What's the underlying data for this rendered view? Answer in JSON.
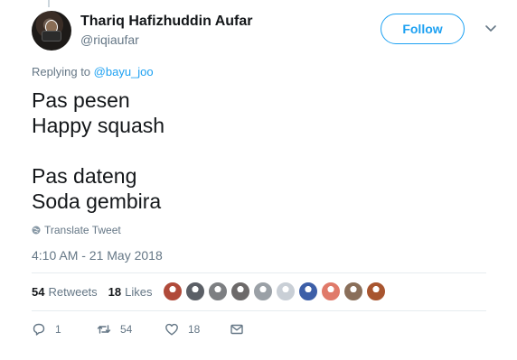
{
  "user": {
    "full_name": "Thariq Hafizhuddin Aufar",
    "handle": "@riqiaufar",
    "avatar_icon": "user-avatar"
  },
  "header": {
    "follow_label": "Follow",
    "menu_icon": "chevron-down-icon"
  },
  "reply": {
    "prefix": "Replying to ",
    "mention": "@bayu_joo"
  },
  "tweet": {
    "lines": [
      "Pas pesen",
      "Happy squash",
      "",
      "Pas dateng",
      "Soda gembira"
    ],
    "translate_label": "Translate Tweet",
    "timestamp": "4:10 AM - 21 May 2018"
  },
  "stats": {
    "retweets_count": "54",
    "retweets_label": "Retweets",
    "likes_count": "18",
    "likes_label": "Likes"
  },
  "likers": [
    {
      "name": "liker-avatar-1",
      "color": "#b04a3a"
    },
    {
      "name": "liker-avatar-2",
      "color": "#5b5f66"
    },
    {
      "name": "liker-avatar-3",
      "color": "#7d7f82"
    },
    {
      "name": "liker-avatar-4",
      "color": "#6d6a6a"
    },
    {
      "name": "liker-avatar-5",
      "color": "#9aa0a6"
    },
    {
      "name": "liker-avatar-6",
      "color": "#c9cfd6"
    },
    {
      "name": "liker-avatar-7",
      "color": "#3d5fa8"
    },
    {
      "name": "liker-avatar-8",
      "color": "#e07a6a"
    },
    {
      "name": "liker-avatar-9",
      "color": "#8a6f5a"
    },
    {
      "name": "liker-avatar-10",
      "color": "#a8552f"
    }
  ],
  "actions": {
    "reply_count": "1",
    "retweet_count": "54",
    "like_count": "18"
  },
  "colors": {
    "accent": "#1da1f2",
    "text": "#14171a",
    "secondary": "#657786",
    "divider": "#e6ecf0"
  }
}
